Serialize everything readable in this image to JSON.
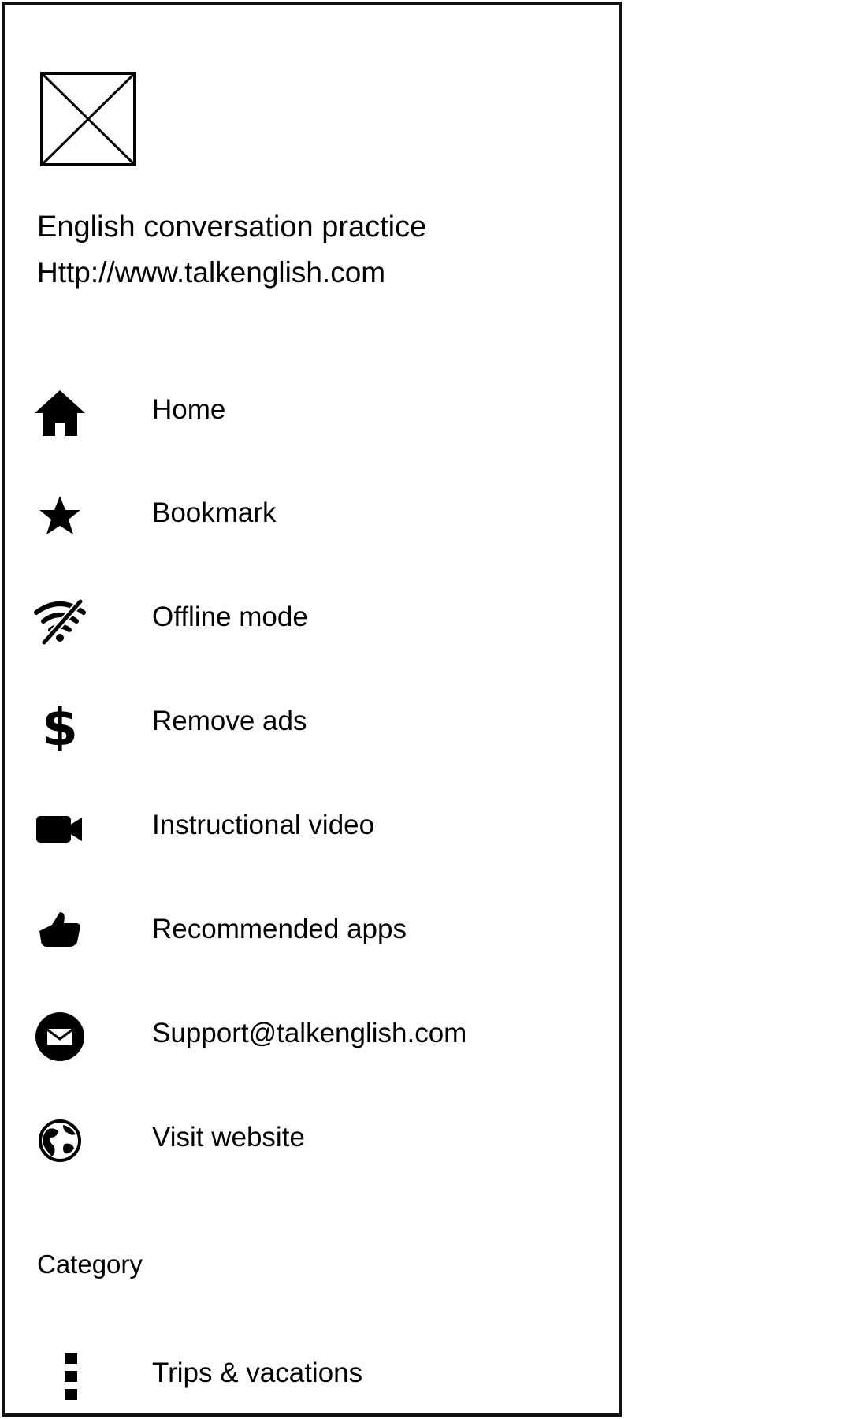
{
  "header": {
    "logo_icon": "image-placeholder-icon",
    "title": "English conversation practice",
    "url": "Http://www.talkenglish.com"
  },
  "menu": [
    {
      "id": "home",
      "label": "Home",
      "icon": "home-icon"
    },
    {
      "id": "bookmark",
      "label": "Bookmark",
      "icon": "star-icon"
    },
    {
      "id": "offline",
      "label": "Offline mode",
      "icon": "wifi-off-icon"
    },
    {
      "id": "remove-ads",
      "label": "Remove ads",
      "icon": "dollar-icon"
    },
    {
      "id": "video",
      "label": "Instructional video",
      "icon": "video-camera-icon"
    },
    {
      "id": "recommended",
      "label": "Recommended apps",
      "icon": "thumbs-up-icon"
    },
    {
      "id": "support",
      "label": "Support@talkenglish.com",
      "icon": "mail-icon"
    },
    {
      "id": "website",
      "label": "Visit website",
      "icon": "globe-icon"
    }
  ],
  "category": {
    "label": "Category",
    "items": [
      {
        "id": "trips",
        "label": "Trips & vacations",
        "icon": "more-vertical-icon"
      }
    ]
  },
  "colors": {
    "background": "#ffffff",
    "foreground": "#000000",
    "border": "#111111"
  }
}
